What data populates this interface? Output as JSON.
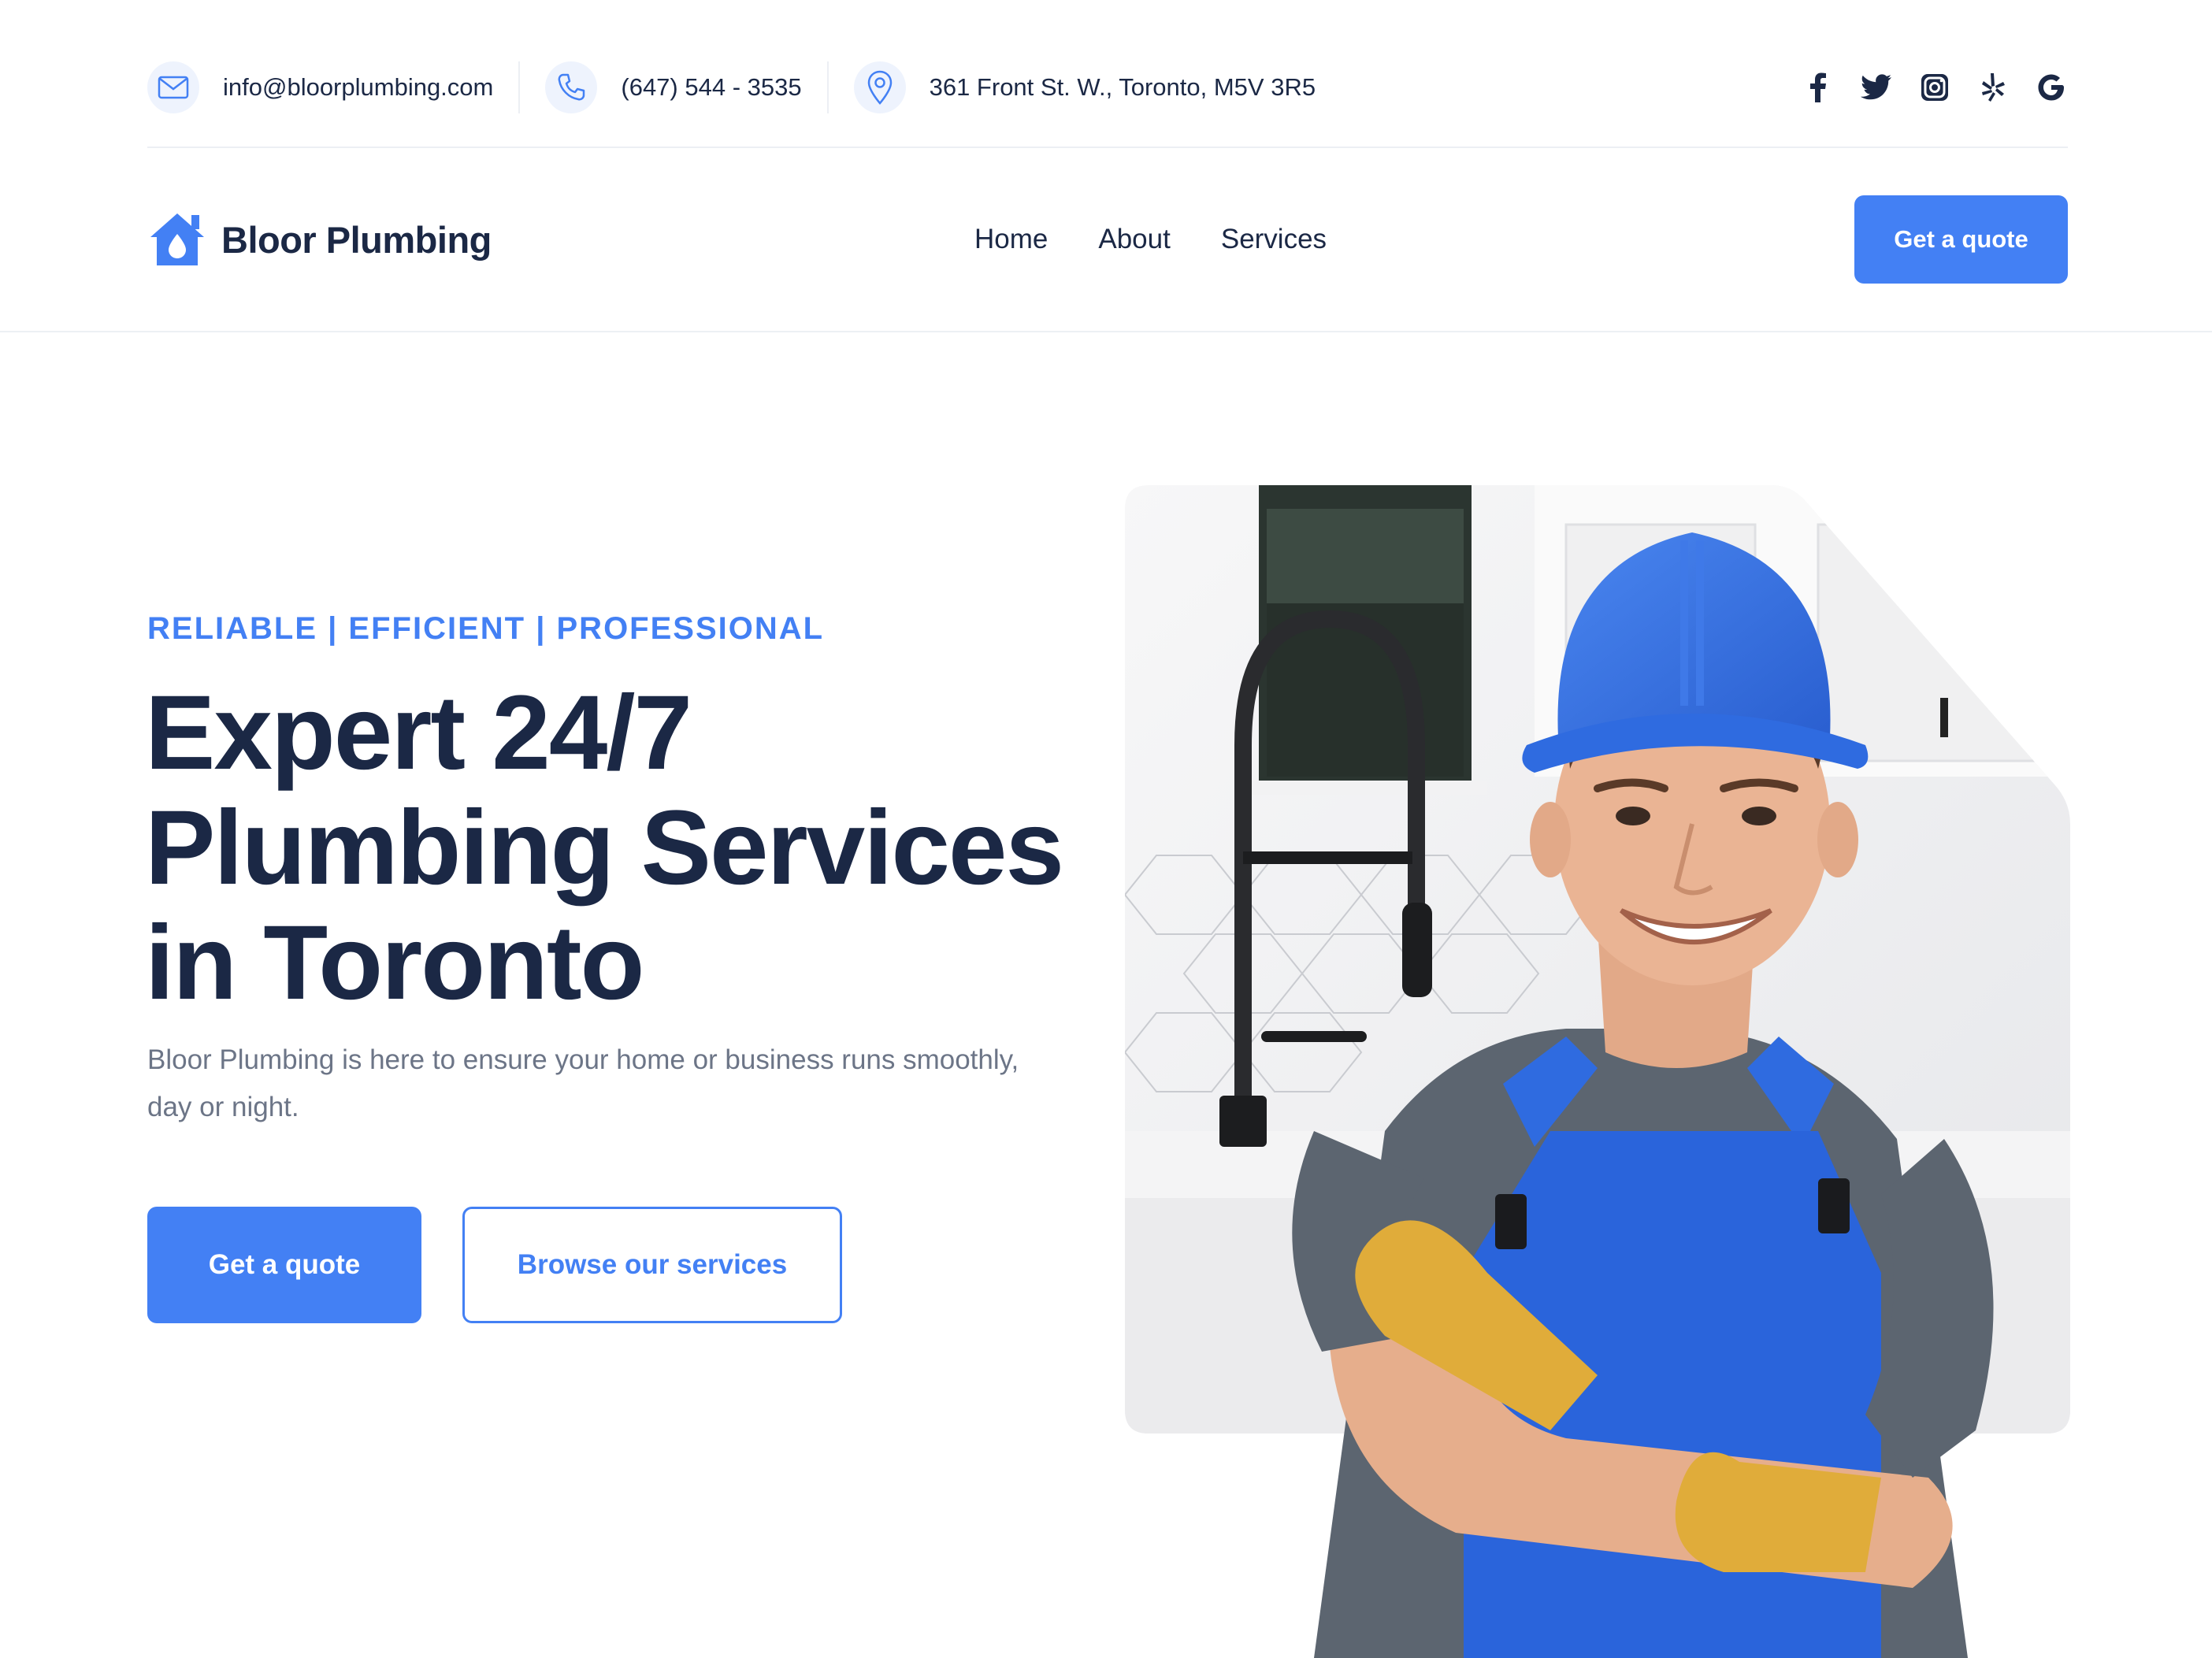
{
  "colors": {
    "accent": "#4380f4",
    "heading": "#1b2845",
    "muted": "#6c7587",
    "icon_bg": "#eef3fd"
  },
  "topbar": {
    "email": {
      "icon": "envelope-icon",
      "text": "info@bloorplumbing.com"
    },
    "phone": {
      "icon": "phone-icon",
      "text": "(647) 544 - 3535"
    },
    "address": {
      "icon": "map-pin-icon",
      "text": "361 Front St. W., Toronto, M5V 3R5"
    },
    "socials": [
      "facebook-icon",
      "twitter-icon",
      "instagram-icon",
      "yelp-icon",
      "google-icon"
    ]
  },
  "nav": {
    "brand": "Bloor Plumbing",
    "links": [
      "Home",
      "About",
      "Services"
    ],
    "cta": "Get a quote"
  },
  "hero": {
    "eyebrow": "RELIABLE | EFFICIENT | PROFESSIONAL",
    "title_lines": [
      "Expert 24/7",
      "Plumbing Services",
      "in Toronto"
    ],
    "subtitle": "Bloor Plumbing is here to ensure your home or business runs smoothly, day or night.",
    "primary_button": "Get a quote",
    "secondary_button": "Browse our services"
  }
}
